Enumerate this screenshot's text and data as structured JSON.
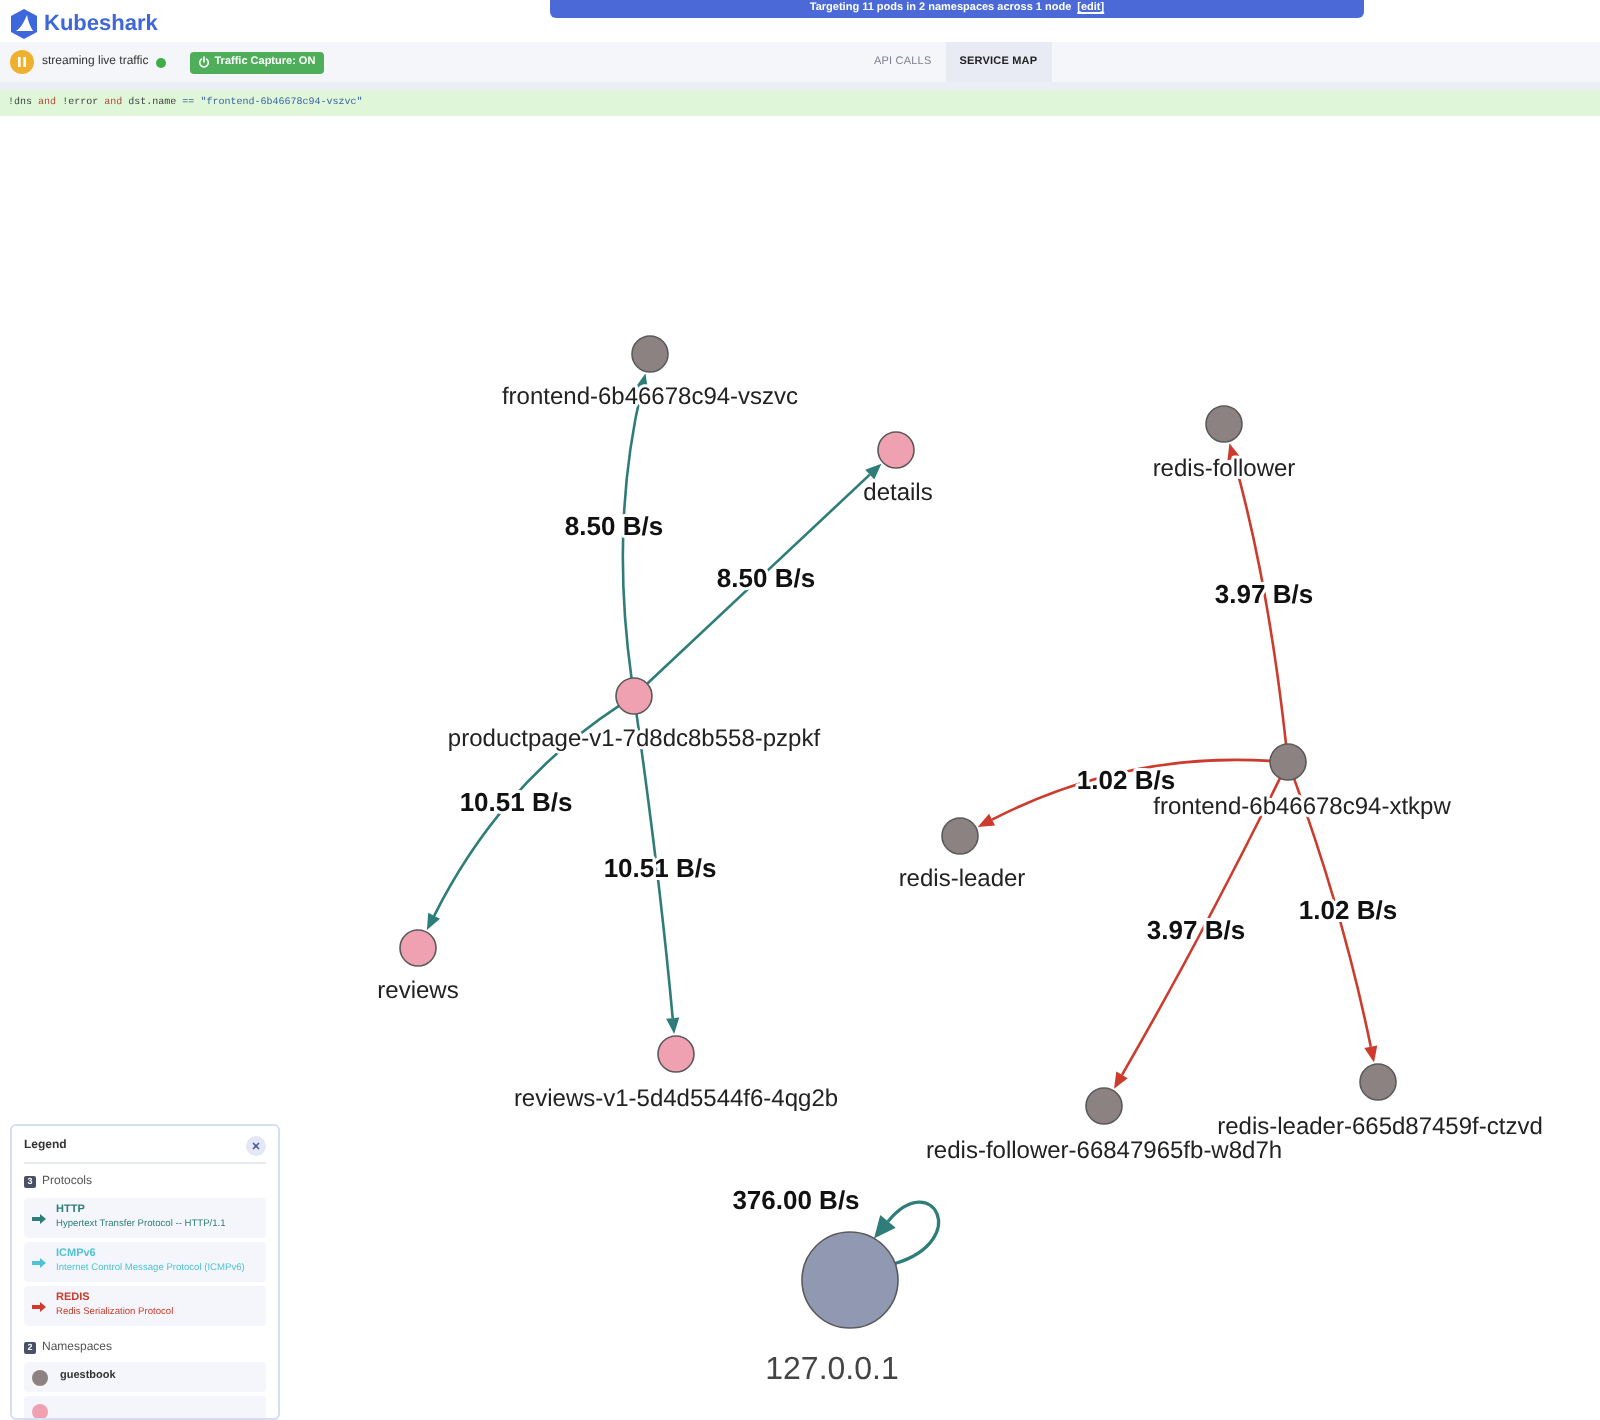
{
  "app": {
    "title": "Kubeshark"
  },
  "banner": {
    "text": "Targeting 11 pods in 2 namespaces across 1 node",
    "link": "[edit]"
  },
  "toolbar": {
    "streaming": true,
    "status": "streaming live traffic",
    "capture": {
      "label": "Traffic Capture: ON",
      "on": true
    }
  },
  "tabs": [
    {
      "label": "API CALLS",
      "selected": false
    },
    {
      "label": "SERVICE MAP",
      "selected": true
    }
  ],
  "query": {
    "tokens": [
      {
        "text": "!dns",
        "kind": "term"
      },
      {
        "text": "and",
        "kind": "keyword"
      },
      {
        "text": "!error",
        "kind": "term"
      },
      {
        "text": "and",
        "kind": "keyword"
      },
      {
        "text": "dst.name",
        "kind": "term"
      },
      {
        "text": "==",
        "kind": "operator"
      },
      {
        "text": "\"frontend-6b46678c94-vszvc\"",
        "kind": "string"
      }
    ]
  },
  "graph": {
    "nodes": [
      {
        "label": "frontend-6b46678c94-vszvc",
        "kind": "pod",
        "color": "#8c8282"
      },
      {
        "label": "redis-follower",
        "kind": "pod",
        "color": "#8c8282"
      },
      {
        "label": "details",
        "kind": "pod",
        "color": "#f0a1b1"
      },
      {
        "label": "productpage-v1-7d8dc8b558-pzpkf",
        "kind": "pod",
        "color": "#f0a1b1"
      },
      {
        "label": "frontend-6b46678c94-xtkpw",
        "kind": "pod",
        "color": "#8c8282"
      },
      {
        "label": "redis-leader",
        "kind": "pod",
        "color": "#8c8282"
      },
      {
        "label": "reviews",
        "kind": "pod",
        "color": "#f0a1b1"
      },
      {
        "label": "reviews-v1-5d4d5544f6-4qg2b",
        "kind": "pod",
        "color": "#f0a1b1"
      },
      {
        "label": "redis-leader-665d87459f-ctzvd",
        "kind": "pod",
        "color": "#8c8282"
      },
      {
        "label": "redis-follower-66847965fb-w8d7h",
        "kind": "pod",
        "color": "#8c8282"
      },
      {
        "label": "127.0.0.1",
        "kind": "host",
        "color": "#9198b2"
      }
    ],
    "edges": [
      {
        "label": "8.50 B/s",
        "kind": "http"
      },
      {
        "label": "8.50 B/s",
        "kind": "http"
      },
      {
        "label": "3.97 B/s",
        "kind": "redis"
      },
      {
        "label": "1.02 B/s",
        "kind": "redis"
      },
      {
        "label": "10.51 B/s",
        "kind": "http"
      },
      {
        "label": "10.51 B/s",
        "kind": "http"
      },
      {
        "label": "1.02 B/s",
        "kind": "redis"
      },
      {
        "label": "3.97 B/s",
        "kind": "redis"
      },
      {
        "label": "376.00 B/s",
        "kind": "http"
      }
    ]
  },
  "legend": {
    "title": "Legend",
    "protocols": {
      "title": "Protocols",
      "count": "3",
      "items": [
        {
          "kind": "http",
          "name": "HTTP",
          "description": "Hypertext Transfer Protocol -- HTTP/1.1",
          "color": "#2e7d78"
        },
        {
          "kind": "icmpv6",
          "name": "ICMPv6",
          "description": "Internet Control Message Protocol (ICMPv6)",
          "color": "#4fc3d3"
        },
        {
          "kind": "redis",
          "name": "REDIS",
          "description": "Redis Serialization Protocol",
          "color": "#cd3b2c"
        }
      ]
    },
    "namespaces": {
      "title": "Namespaces",
      "count": "2",
      "items": [
        {
          "name": "guestbook",
          "color": "#8c8282"
        },
        {
          "color": "#f0a1b1"
        }
      ]
    }
  }
}
